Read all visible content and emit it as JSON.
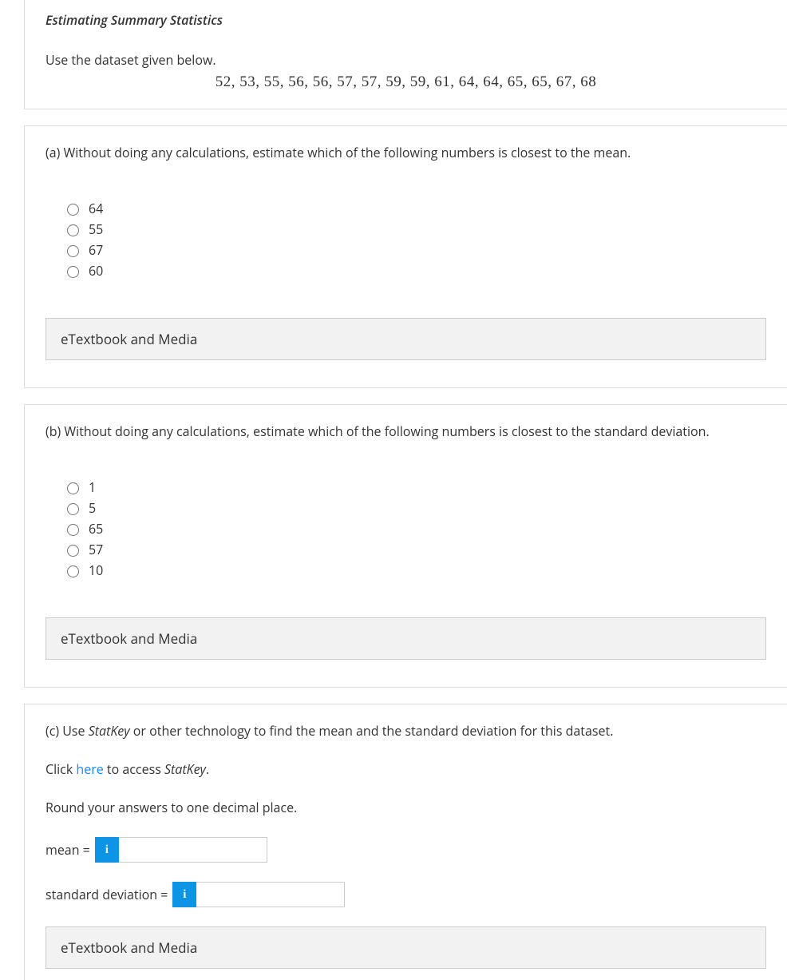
{
  "intro": {
    "title": "Estimating Summary Statistics",
    "instruction": "Use the dataset given below.",
    "dataset": "52, 53, 55, 56, 56, 57, 57, 59, 59, 61, 64, 64, 65, 65, 67, 68"
  },
  "part_a": {
    "prompt": "(a) Without doing any calculations, estimate which of the following numbers is closest to the mean.",
    "options": [
      "64",
      "55",
      "67",
      "60"
    ]
  },
  "part_b": {
    "prompt": "(b) Without doing any calculations, estimate which of the following numbers is closest to the standard deviation.",
    "options": [
      "1",
      "5",
      "65",
      "57",
      "10"
    ]
  },
  "part_c": {
    "line1_pre": "(c) Use ",
    "line1_ital": "StatKey",
    "line1_post": " or other technology to find the mean and the standard deviation for this dataset.",
    "line2_pre": "Click ",
    "line2_link": "here",
    "line2_mid": " to access ",
    "line2_ital": "StatKey",
    "line2_end": ".",
    "line3": "Round your answers to one decimal place.",
    "mean_label": "mean = ",
    "sd_label": "standard deviation = "
  },
  "etextbook_label": "eTextbook and Media",
  "info_glyph": "i"
}
